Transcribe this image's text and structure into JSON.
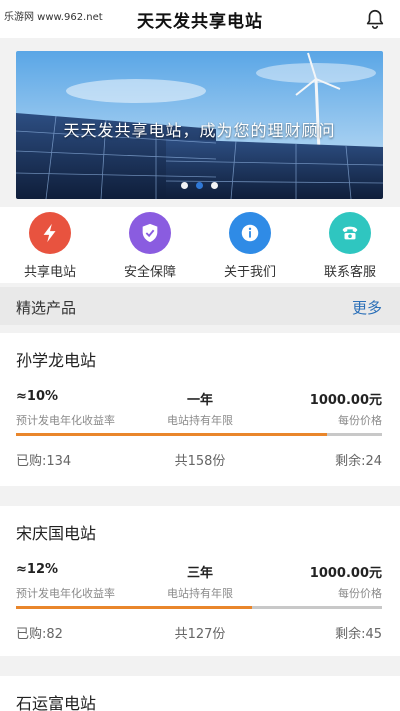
{
  "watermark": "乐游网 www.962.net",
  "header": {
    "title": "天天发共享电站",
    "bell_icon": "bell-icon"
  },
  "banner": {
    "caption": "天天发共享电站，成为您的理财顾问",
    "slides": 3,
    "active_slide": 1
  },
  "quick_nav": [
    {
      "label": "共享电站",
      "icon": "lightning-icon",
      "color": "#e8533f"
    },
    {
      "label": "安全保障",
      "icon": "shield-check-icon",
      "color": "#8a5ce0"
    },
    {
      "label": "关于我们",
      "icon": "info-icon",
      "color": "#2f8be6"
    },
    {
      "label": "联系客服",
      "icon": "phone-icon",
      "color": "#2fc6c0"
    }
  ],
  "section": {
    "title": "精选产品",
    "more": "更多"
  },
  "products": [
    {
      "name": "孙学龙电站",
      "rate": "≈10%",
      "rate_label": "预计发电年化收益率",
      "term": "一年",
      "term_label": "电站持有年限",
      "price": "1000.00元",
      "price_label": "每份价格",
      "progress": 0.85,
      "bought": "已购:134",
      "total": "共158份",
      "remaining": "剩余:24"
    },
    {
      "name": "宋庆国电站",
      "rate": "≈12%",
      "rate_label": "预计发电年化收益率",
      "term": "三年",
      "term_label": "电站持有年限",
      "price": "1000.00元",
      "price_label": "每份价格",
      "progress": 0.645,
      "bought": "已购:82",
      "total": "共127份",
      "remaining": "剩余:45"
    },
    {
      "name": "石运富电站"
    }
  ],
  "colors": {
    "accent": "#2a6fb8",
    "progress": "#e9862b"
  }
}
